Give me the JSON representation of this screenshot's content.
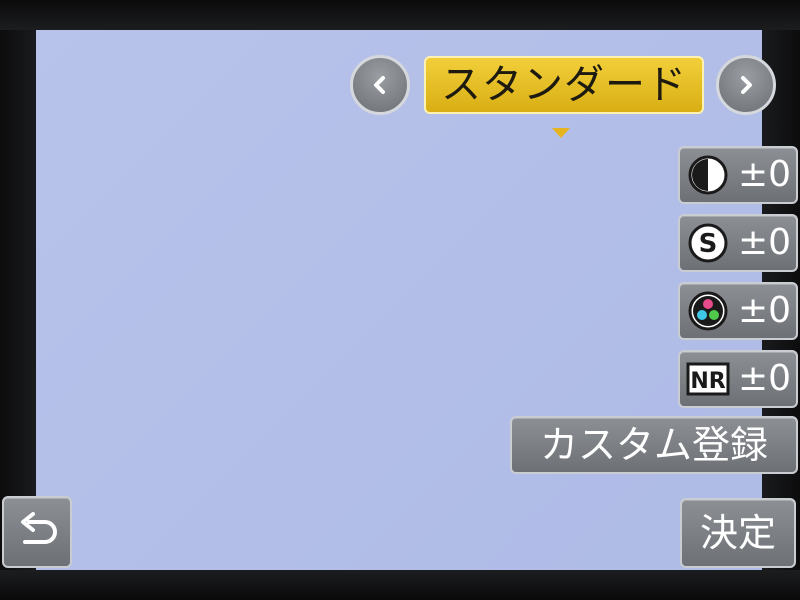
{
  "mode": {
    "current": "スタンダード",
    "prev_icon": "chevron-left-icon",
    "next_icon": "chevron-right-icon"
  },
  "params": [
    {
      "icon": "contrast-icon",
      "value": "±0"
    },
    {
      "icon": "sharpness-icon",
      "value": "±0"
    },
    {
      "icon": "saturation-icon",
      "value": "±0"
    },
    {
      "icon": "noise-reduction-icon",
      "icon_text": "NR",
      "value": "±0"
    }
  ],
  "buttons": {
    "custom_register": "カスタム登録",
    "confirm": "決定",
    "back_icon": "return-arrow-icon"
  },
  "colors": {
    "accent_yellow": "#E6B41E",
    "button_gray": "#7D8186",
    "preview_blue": "#B3BFE8"
  }
}
